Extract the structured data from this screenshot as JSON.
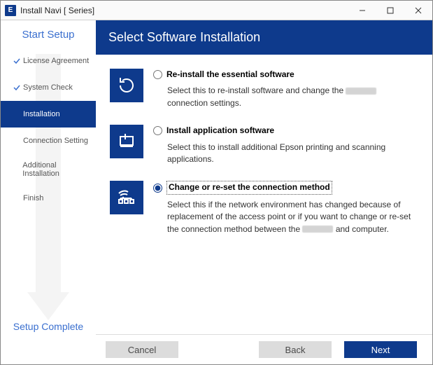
{
  "window": {
    "app_icon_letter": "E",
    "title_prefix": "Install Navi [",
    "title_mid": "          Series]"
  },
  "sidebar": {
    "title": "Start Setup",
    "footer": "Setup Complete",
    "steps": [
      {
        "label": "License Agreement",
        "done": true,
        "active": false
      },
      {
        "label": "System Check",
        "done": true,
        "active": false
      },
      {
        "label": "Installation",
        "done": false,
        "active": true
      },
      {
        "label": "Connection Setting",
        "done": false,
        "active": false
      },
      {
        "label": "Additional Installation",
        "done": false,
        "active": false
      },
      {
        "label": "Finish",
        "done": false,
        "active": false
      }
    ]
  },
  "main": {
    "header": "Select Software Installation",
    "options": [
      {
        "id": "reinstall",
        "title": "Re-install the essential software",
        "desc_pre": "Select this to re-install software and change the ",
        "desc_post": " connection settings.",
        "selected": false,
        "has_redaction": true
      },
      {
        "id": "install-apps",
        "title": "Install application software",
        "desc_pre": "Select this to install additional Epson printing and scanning applications.",
        "desc_post": "",
        "selected": false,
        "has_redaction": false
      },
      {
        "id": "change-conn",
        "title": "Change or re-set the connection method",
        "desc_pre": "Select this if the network environment has changed because of replacement of the access point or if you want to change or re-set the connection method between the ",
        "desc_post": " and computer.",
        "selected": true,
        "has_redaction": true
      }
    ]
  },
  "footer": {
    "cancel": "Cancel",
    "back": "Back",
    "next": "Next"
  }
}
